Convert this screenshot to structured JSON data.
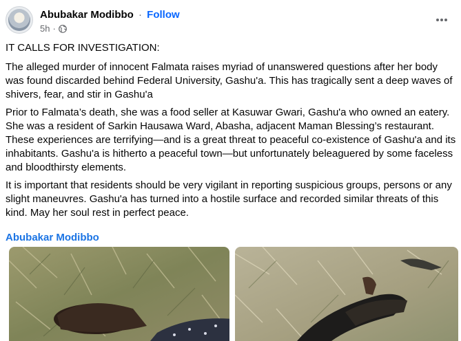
{
  "post": {
    "author": "Abubakar Modibbo",
    "separator": "·",
    "follow_label": "Follow",
    "time": "5h",
    "audience_icon": "globe-icon",
    "more_icon": "more-options-icon",
    "paragraphs": [
      "IT CALLS FOR INVESTIGATION:",
      "The alleged murder of innocent Falmata raises myriad of unanswered questions after her body was found discarded behind Federal University, Gashu'a. This has tragically sent a deep waves of shivers, fear, and stir in Gashu'a",
      "Prior to Falmata’s death, she was a food seller at Kasuwar Gwari, Gashu'a who owned an eatery. She was a resident of Sarkin Hausawa Ward, Abasha, adjacent Maman Blessing’s restaurant. These experiences are terrifying—and is a great threat to peaceful co-existence of Gashu'a and its inhabitants. Gashu'a is hitherto a peaceful town—but unfortunately beleaguered by some faceless and bloodthirsty elements.",
      "It is important that residents should be very vigilant in reporting suspicious groups, persons or any slight maneuvres. Gashu'a has turned into a hostile surface and recorded similar threats of this kind. May her soul rest in perfect peace."
    ],
    "mention": "Abubakar Modibbo"
  },
  "colors": {
    "link_blue": "#0866ff",
    "mention_blue": "#1b74e4",
    "secondary_text": "#65676b"
  }
}
